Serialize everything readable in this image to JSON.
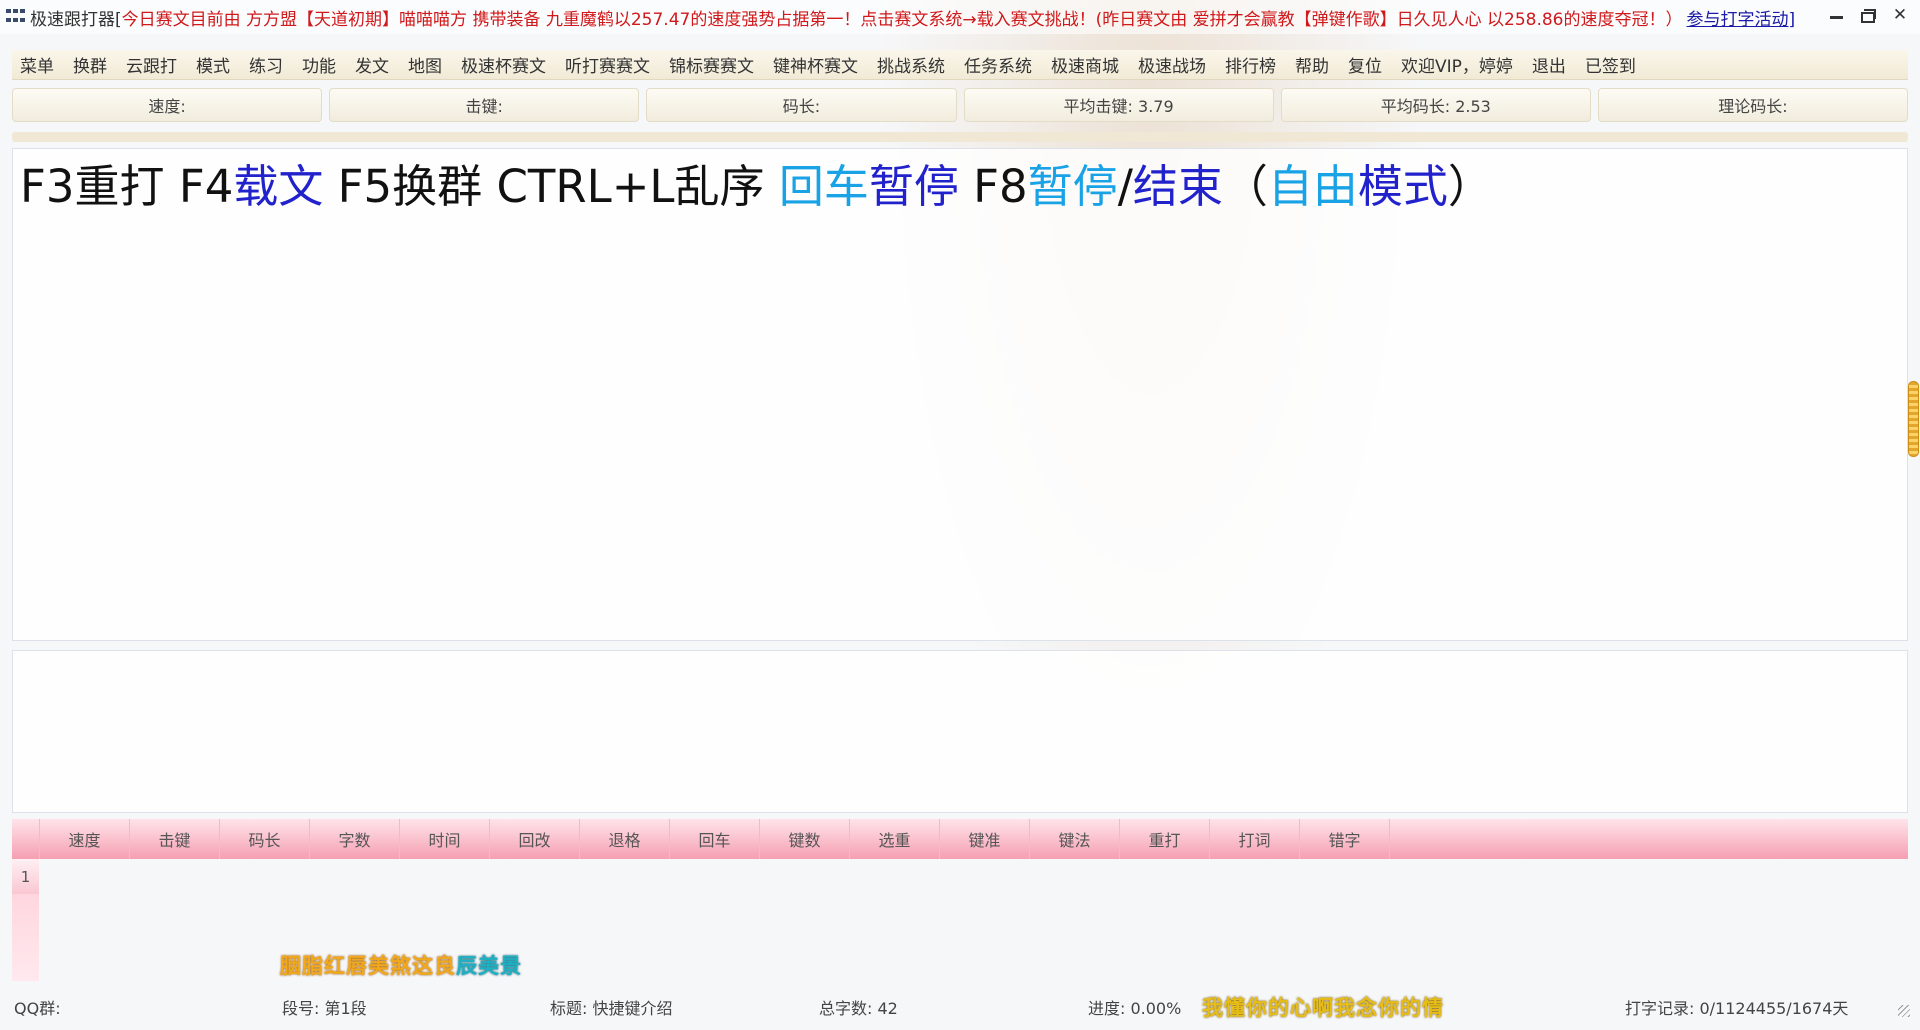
{
  "titlebar": {
    "app_name": "极速跟打器[",
    "marquee": "今日赛文目前由 方方盟【天道初期】喵喵喵方 携带装备 九重魔鹤以257.47的速度强势占据第一！点击赛文系统→载入赛文挑战！(昨日赛文由 爱拼才会赢教【弹键作歌】日久见人心 以258.86的速度夺冠！）",
    "activity_link": "参与打字活动]"
  },
  "menu": {
    "items": [
      "菜单",
      "换群",
      "云跟打",
      "模式",
      "练习",
      "功能",
      "发文",
      "地图",
      "极速杯赛文",
      "听打赛赛文",
      "锦标赛赛文",
      "键神杯赛文",
      "挑战系统",
      "任务系统",
      "极速商城",
      "极速战场",
      "排行榜",
      "帮助",
      "复位",
      "欢迎VIP，婷婷",
      "退出",
      "已签到"
    ]
  },
  "stats": {
    "speed": "速度:",
    "keystroke": "击键:",
    "code_length": "码长:",
    "avg_keystroke": "平均击键: 3.79",
    "avg_code_length": "平均码长: 2.53",
    "theory_code_length": "理论码长:"
  },
  "article": {
    "segments": [
      {
        "text": "F3重打 F4",
        "color": "#111111"
      },
      {
        "text": "载文",
        "color": "#2222cc"
      },
      {
        "text": " F5换群 CTRL+L乱序 ",
        "color": "#111111"
      },
      {
        "text": "回车",
        "color": "#19a3e6"
      },
      {
        "text": "暂停",
        "color": "#2222cc"
      },
      {
        "text": " F8",
        "color": "#111111"
      },
      {
        "text": "暂停",
        "color": "#19a3e6"
      },
      {
        "text": "/",
        "color": "#111111"
      },
      {
        "text": "结束",
        "color": "#2222cc"
      },
      {
        "text": "（",
        "color": "#111111"
      },
      {
        "text": "自由",
        "color": "#19a3e6"
      },
      {
        "text": "模式",
        "color": "#2222cc"
      },
      {
        "text": "）",
        "color": "#111111"
      }
    ]
  },
  "input": {
    "value": ""
  },
  "results": {
    "columns": [
      "速度",
      "击键",
      "码长",
      "字数",
      "时间",
      "回改",
      "退格",
      "回车",
      "键数",
      "选重",
      "键准",
      "键法",
      "重打",
      "打词",
      "错字"
    ],
    "row_index": "1"
  },
  "lyrics": {
    "line1_main": "胭脂红唇美煞这良",
    "line1_tail": "辰美景",
    "line2": "我懂你的心啊我念你的情"
  },
  "status": {
    "qq_group": "QQ群:",
    "segment": "段号: 第1段",
    "title": "标题: 快捷键介绍",
    "total_chars": "总字数: 42",
    "progress": "进度: 0.00%",
    "typing_record": "打字记录: 0/1124455/1674天"
  },
  "progress_value": 0
}
